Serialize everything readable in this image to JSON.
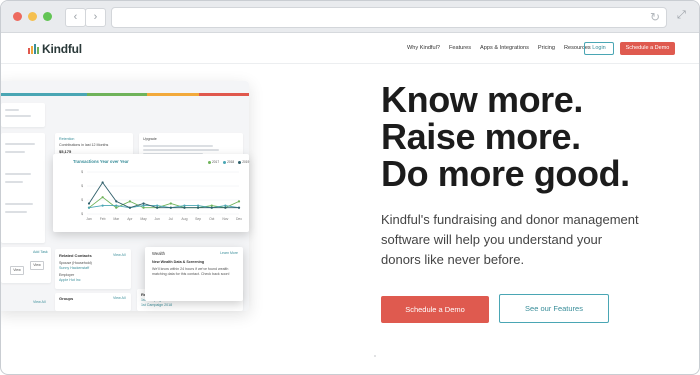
{
  "browser": {
    "back_glyph": "‹",
    "forward_glyph": "›",
    "reload_glyph": "↻",
    "expand_glyph": "⤢"
  },
  "brand": {
    "name": "Kindful",
    "bar_colors": [
      "#e0584d",
      "#f2a93b",
      "#3a8e9a",
      "#6fb35a"
    ]
  },
  "nav": {
    "items": [
      "Why Kindful?",
      "Features",
      "Apps & Integrations",
      "Pricing",
      "Resources"
    ],
    "login_label": "Login",
    "demo_label": "Schedule a Demo"
  },
  "hero": {
    "headline": [
      "Know more.",
      "Raise more.",
      "Do more good."
    ],
    "subtext": "Kindful's fundraising and donor management software will help you understand your donors like never before.",
    "cta_primary": "Schedule a Demo",
    "cta_secondary": "See our Features"
  },
  "colors": {
    "accent_red": "#df5a4f",
    "accent_teal": "#3a8e9a",
    "stripe": [
      "#4aa6b4",
      "#6fb35a",
      "#f2a93b",
      "#e0584d"
    ]
  },
  "dashboard": {
    "retention_label": "Retention",
    "retention_sub": "Contributions in last 12 Months",
    "retention_value": "$5,175",
    "upgrade_label": "Upgrade",
    "row_value": "$50",
    "row_label": "Trans",
    "related_label": "Related Contacts",
    "view_all": "View All",
    "related_items": [
      "Spouse (Household)",
      "Sunny Hackenstaff",
      "Employer",
      "Apple Hut Inc"
    ],
    "add_task": "Add Task",
    "view_btn": "View",
    "groups_label": "Groups",
    "reports_label": "Reports",
    "report_items": [
      "1st Campaign 2018",
      "1st Campaign 2018"
    ]
  },
  "chart_data": {
    "type": "line",
    "title": "Transactions Year over Year",
    "categories": [
      "Jan",
      "Feb",
      "Mar",
      "Apr",
      "May",
      "Jun",
      "Jul",
      "Aug",
      "Sep",
      "Oct",
      "Nov",
      "Dec"
    ],
    "series": [
      {
        "name": "2017",
        "color": "#6fb35a",
        "values": [
          1.5,
          4,
          1.5,
          3,
          1.5,
          1.5,
          2.5,
          1.5,
          1.5,
          2,
          1.5,
          3
        ]
      },
      {
        "name": "2018",
        "color": "#4aa6b4",
        "values": [
          1.5,
          2,
          2,
          1.5,
          2,
          2,
          1.5,
          2,
          2,
          1.5,
          2,
          1.5
        ]
      },
      {
        "name": "2019",
        "color": "#2f5f6a",
        "values": [
          2.5,
          7.5,
          3,
          1.5,
          2.5,
          1.5,
          1.5,
          1.5,
          1.5,
          1.5,
          1.5,
          1.5
        ]
      }
    ],
    "yticks": [
      "$",
      "$",
      "$",
      "$"
    ],
    "ylim": [
      0,
      10
    ]
  },
  "wealth": {
    "title": "Wealth",
    "learn_more": "Learn More",
    "heading": "New Wealth Data & Screening",
    "body": "We'll know within 24 hours if we've found wealth matching data for this contact. Check back soon!"
  }
}
